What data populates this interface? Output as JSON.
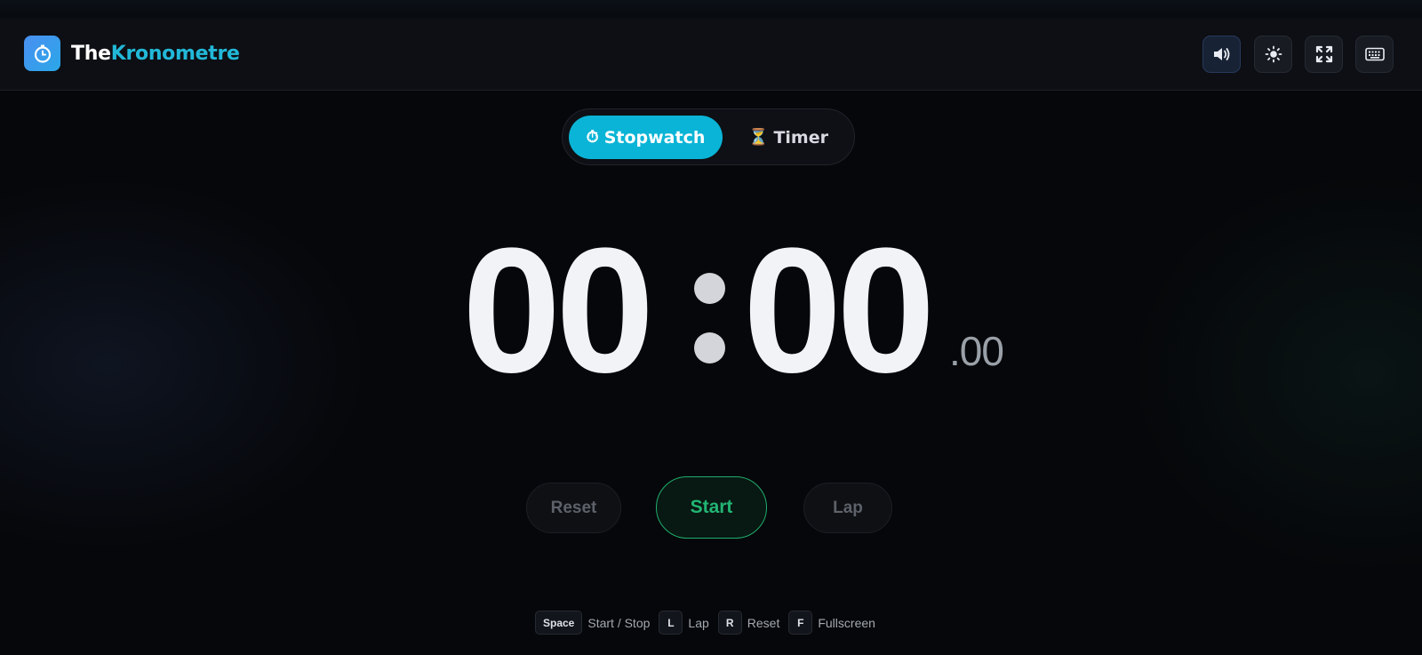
{
  "header": {
    "brand_part1": "The",
    "brand_part2": "Kronometre",
    "logo_icon": "stopwatch-icon",
    "buttons": [
      {
        "name": "sound-toggle-button",
        "icon": "speaker-icon",
        "active": true
      },
      {
        "name": "theme-toggle-button",
        "icon": "sun-icon",
        "active": false
      },
      {
        "name": "fullscreen-button",
        "icon": "fullscreen-icon",
        "active": false
      },
      {
        "name": "keyboard-shortcuts-button",
        "icon": "keyboard-icon",
        "active": false
      }
    ]
  },
  "mode_switch": {
    "stopwatch_icon": "⏱",
    "stopwatch_label": "Stopwatch",
    "timer_icon": "⏳",
    "timer_label": "Timer",
    "active": "Stopwatch"
  },
  "clock": {
    "minutes": "00",
    "seconds": "00",
    "hundredths": ".00"
  },
  "controls": {
    "reset_label": "Reset",
    "start_label": "Start",
    "lap_label": "Lap"
  },
  "shortcuts": [
    {
      "key": "Space",
      "label": "Start / Stop"
    },
    {
      "key": "L",
      "label": "Lap"
    },
    {
      "key": "R",
      "label": "Reset"
    },
    {
      "key": "F",
      "label": "Fullscreen"
    }
  ],
  "colors": {
    "accent": "#0ab4d6",
    "brand_accent": "#22b8d8",
    "start_green": "#22b574",
    "background": "#06070a"
  }
}
